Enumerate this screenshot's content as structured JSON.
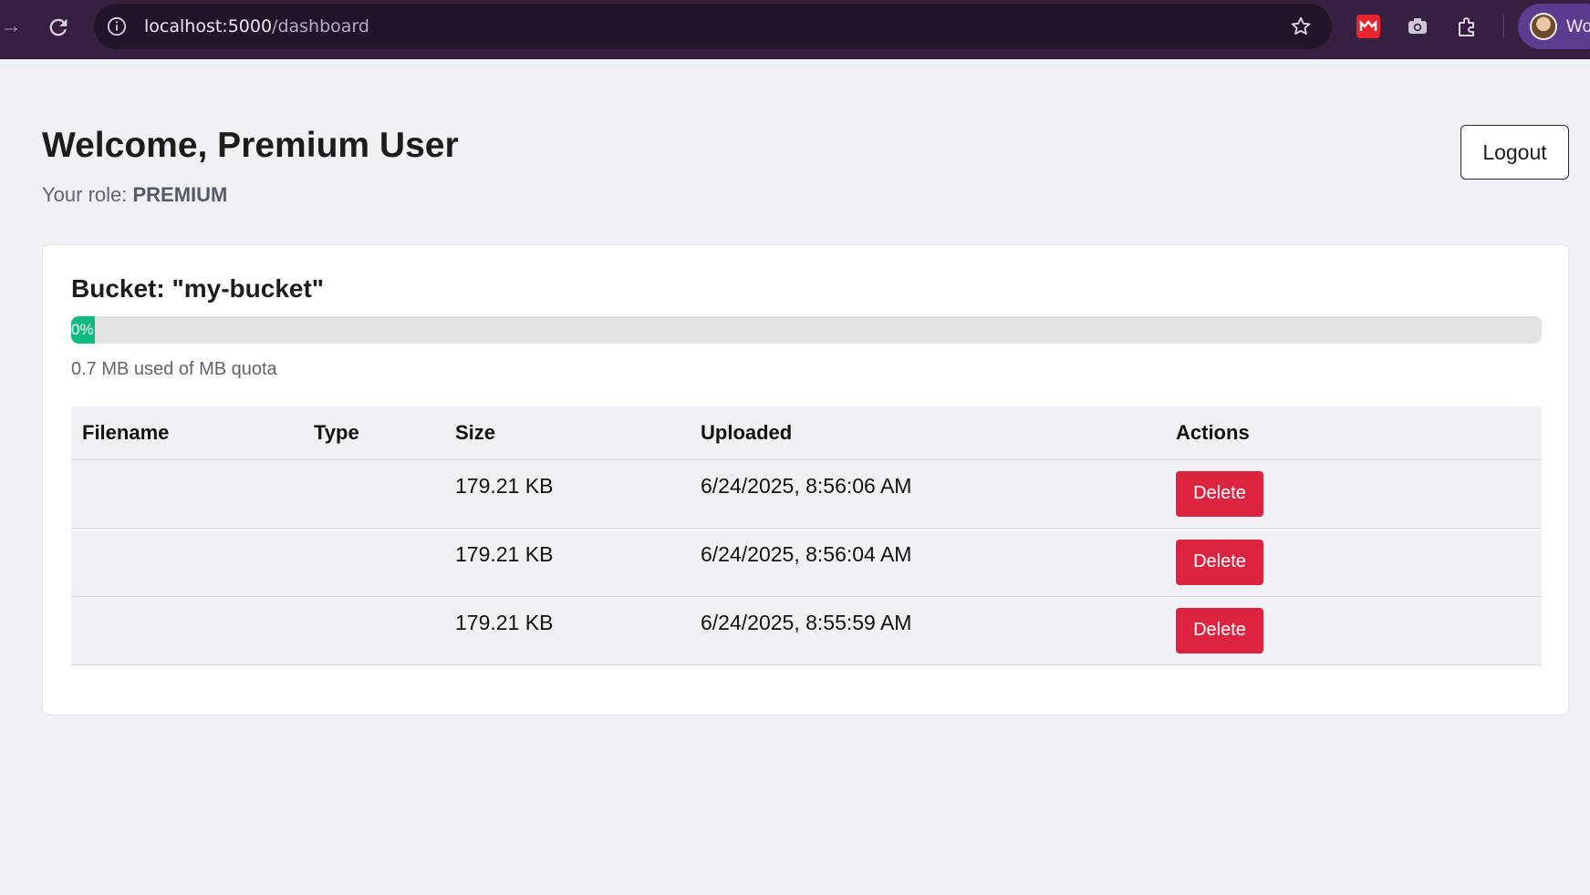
{
  "browser": {
    "url_host": "localhost:5000",
    "url_path": "/dashboard",
    "profile_name": "Wo"
  },
  "header": {
    "title": "Welcome, Premium User",
    "role_prefix": "Your role: ",
    "role_value": "PREMIUM",
    "logout_label": "Logout"
  },
  "bucket": {
    "title": "Bucket: \"my-bucket\"",
    "progress_label": "0%",
    "progress_fraction": 0,
    "usage_text": "0.7 MB used of MB quota",
    "accent_color": "#10b981"
  },
  "table": {
    "headers": {
      "filename": "Filename",
      "type": "Type",
      "size": "Size",
      "uploaded": "Uploaded",
      "actions": "Actions"
    },
    "rows": [
      {
        "filename": "",
        "type": "",
        "size": "179.21 KB",
        "uploaded": "6/24/2025, 8:56:06 AM",
        "action": "Delete"
      },
      {
        "filename": "",
        "type": "",
        "size": "179.21 KB",
        "uploaded": "6/24/2025, 8:56:04 AM",
        "action": "Delete"
      },
      {
        "filename": "",
        "type": "",
        "size": "179.21 KB",
        "uploaded": "6/24/2025, 8:55:59 AM",
        "action": "Delete"
      }
    ],
    "delete_color": "#dc2440"
  }
}
